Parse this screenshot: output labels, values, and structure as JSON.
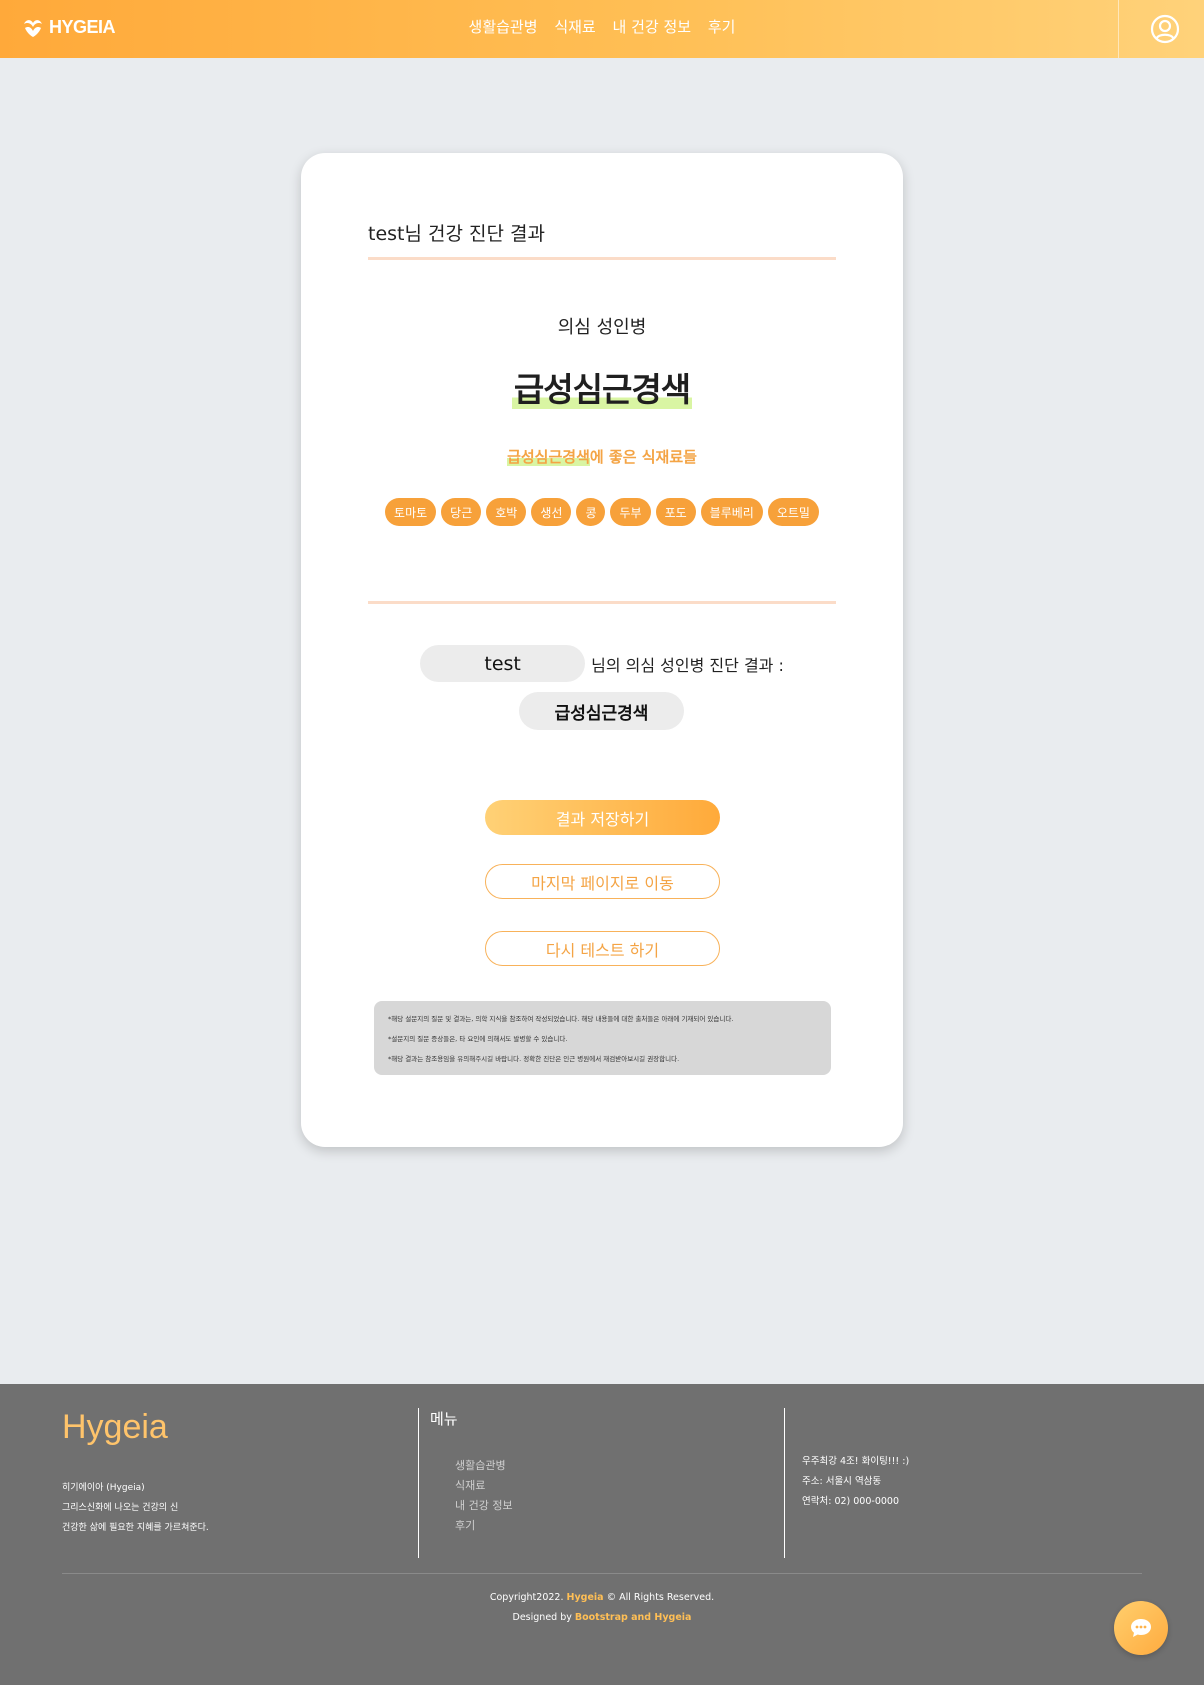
{
  "header": {
    "logo_text": "HYGEIA",
    "nav": [
      "생활습관병",
      "식재료",
      "내 건강 정보",
      "후기"
    ]
  },
  "card": {
    "title": "test님 건강 진단 결과",
    "suspected_label": "의심 성인병",
    "disease": "급성심근경색",
    "foods_title_disease": "급성심근경색",
    "foods_title_suffix": "에 좋은 식재료들",
    "foods": [
      "토마토",
      "당근",
      "호박",
      "생선",
      "콩",
      "두부",
      "포도",
      "블루베리",
      "오트밀"
    ],
    "result": {
      "user_name": "test",
      "text": "님의 의심 성인병 진단 결과 :",
      "disease": "급성심근경색"
    },
    "buttons": {
      "save": "결과 저장하기",
      "last_page": "마지막 페이지로 이동",
      "retry": "다시 테스트 하기"
    },
    "notices": [
      "*해당 설문지의 질문 및 결과는, 의학 지식을 참조하여 작성되었습니다. 해당 내용들에 대한 출처들은 아래에 기재되어 있습니다.",
      "*설문지의 질문 증상들은, 타 요인에 의해서도 발병할 수 있습니다.",
      "*해당 결과는 참조용임을 유의해주시길 바랍니다. 정확한 진단은 인근 병원에서 재검받아보시길 권장합니다."
    ]
  },
  "footer": {
    "brand": "Hygeia",
    "desc": [
      "히기에이아 (Hygeia)",
      "그리스신화에 나오는 건강의 신",
      "건강한 삶에 필요한 지혜를 가르쳐준다."
    ],
    "menu_title": "메뉴",
    "menu": [
      "생활습관병",
      "식재료",
      "내 건강 정보",
      "후기"
    ],
    "info": [
      "우주최강 4조! 화이팅!!! :)",
      "주소: 서울시 역삼동",
      "연락처: 02) 000-0000"
    ],
    "copyright_prefix": "Copyright2022. ",
    "copyright_brand": "Hygeia",
    "copyright_suffix": " © All Rights Reserved.",
    "designed_prefix": "Designed by ",
    "designed_by": "Bootstrap and Hygeia"
  },
  "colors": {
    "accent": "#f7a13a",
    "highlight": "#d9f5a3",
    "footer_bg": "#707070"
  },
  "icons": [
    "logo-icon",
    "user-circle-icon",
    "chat-icon"
  ]
}
